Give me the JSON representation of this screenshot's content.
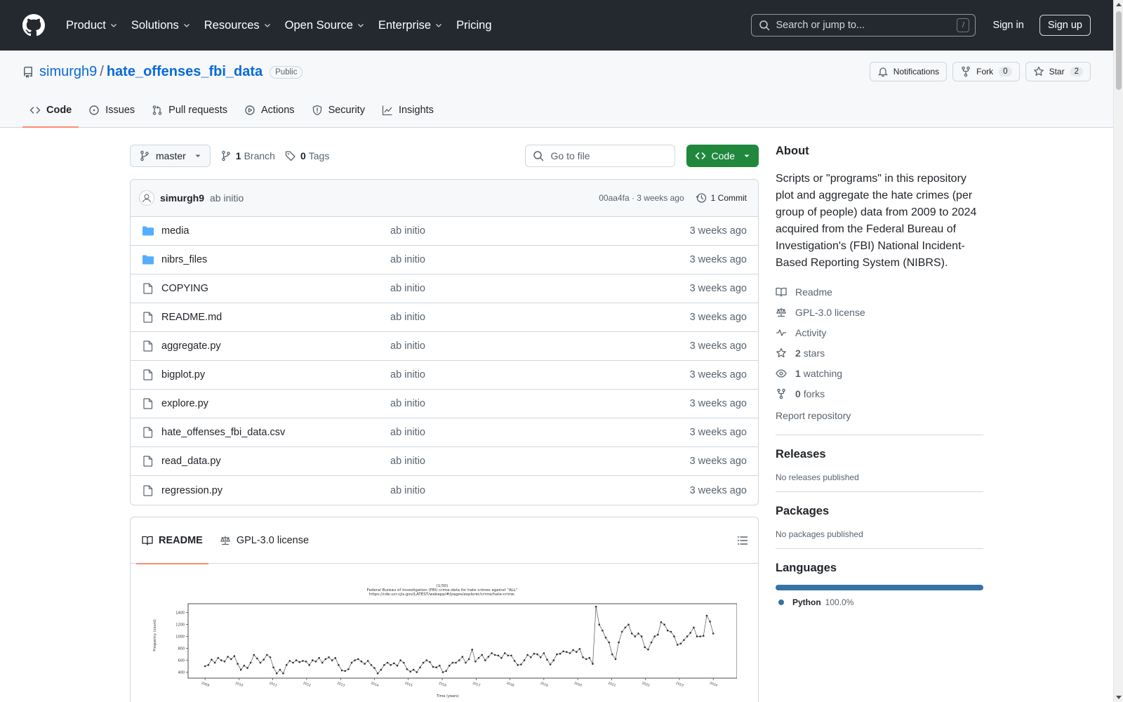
{
  "topnav": {
    "items": [
      {
        "label": "Product",
        "has_menu": true
      },
      {
        "label": "Solutions",
        "has_menu": true
      },
      {
        "label": "Resources",
        "has_menu": true
      },
      {
        "label": "Open Source",
        "has_menu": true
      },
      {
        "label": "Enterprise",
        "has_menu": true
      },
      {
        "label": "Pricing",
        "has_menu": false
      }
    ],
    "search_placeholder": "Search or jump to...",
    "search_shortcut": "/",
    "signin_label": "Sign in",
    "signup_label": "Sign up"
  },
  "repo": {
    "owner": "simurgh9",
    "separator": "/",
    "name": "hate_offenses_fbi_data",
    "visibility": "Public",
    "notifications_label": "Notifications",
    "fork_label": "Fork",
    "fork_count": "0",
    "star_label": "Star",
    "star_count": "2",
    "tabs": [
      {
        "label": "Code",
        "icon": "code-icon",
        "active": true
      },
      {
        "label": "Issues",
        "icon": "issue-icon",
        "active": false
      },
      {
        "label": "Pull requests",
        "icon": "pull-request-icon",
        "active": false
      },
      {
        "label": "Actions",
        "icon": "play-icon",
        "active": false
      },
      {
        "label": "Security",
        "icon": "shield-icon",
        "active": false
      },
      {
        "label": "Insights",
        "icon": "graph-icon",
        "active": false
      }
    ]
  },
  "toolbar": {
    "branch": "master",
    "branch_count": "1",
    "branch_label": "Branch",
    "tag_count": "0",
    "tag_label": "Tags",
    "goto_placeholder": "Go to file",
    "code_button": "Code"
  },
  "commit": {
    "author": "simurgh9",
    "message": "ab initio",
    "meta": "00aa4fa · 3 weeks ago",
    "count_label": "1 Commit"
  },
  "files": [
    {
      "name": "media",
      "type": "dir",
      "message": "ab initio",
      "date": "3 weeks ago"
    },
    {
      "name": "nibrs_files",
      "type": "dir",
      "message": "ab initio",
      "date": "3 weeks ago"
    },
    {
      "name": "COPYING",
      "type": "file",
      "message": "ab initio",
      "date": "3 weeks ago"
    },
    {
      "name": "README.md",
      "type": "file",
      "message": "ab initio",
      "date": "3 weeks ago"
    },
    {
      "name": "aggregate.py",
      "type": "file",
      "message": "ab initio",
      "date": "3 weeks ago"
    },
    {
      "name": "bigplot.py",
      "type": "file",
      "message": "ab initio",
      "date": "3 weeks ago"
    },
    {
      "name": "explore.py",
      "type": "file",
      "message": "ab initio",
      "date": "3 weeks ago"
    },
    {
      "name": "hate_offenses_fbi_data.csv",
      "type": "file",
      "message": "ab initio",
      "date": "3 weeks ago"
    },
    {
      "name": "read_data.py",
      "type": "file",
      "message": "ab initio",
      "date": "3 weeks ago"
    },
    {
      "name": "regression.py",
      "type": "file",
      "message": "ab initio",
      "date": "3 weeks ago"
    }
  ],
  "readme": {
    "tab_readme": "README",
    "tab_license": "GPL-3.0 license",
    "plot_title_1": "(1/30)",
    "plot_title_2": "Federal Bureau of Investigation (FBI) crime-data for hate crimes against \"ALL\"",
    "plot_title_3": "https://cde.ucr.cjis.gov/LATEST/webapp/#/pages/explorer/crime/hate-crime.",
    "plot_ylabel": "Frequency (count)",
    "plot_xlabel": "Time (years)"
  },
  "about": {
    "title": "About",
    "description": "Scripts or \"programs\" in this repository plot and aggregate the hate crimes (per group of people) data from 2009 to 2024 acquired from the Federal Bureau of Investigation's (FBI) National Incident-Based Reporting System (NIBRS).",
    "readme": "Readme",
    "license": "GPL-3.0 license",
    "activity": "Activity",
    "stars_count": "2",
    "stars_label": "stars",
    "watching_count": "1",
    "watching_label": "watching",
    "forks_count": "0",
    "forks_label": "forks",
    "report": "Report repository"
  },
  "releases": {
    "title": "Releases",
    "text": "No releases published"
  },
  "packages": {
    "title": "Packages",
    "text": "No packages published"
  },
  "languages": {
    "title": "Languages",
    "items": [
      {
        "name": "Python",
        "percent": "100.0%",
        "color": "#3572a5"
      }
    ]
  },
  "chart_data": {
    "type": "line",
    "title": "(1/30) Federal Bureau of Investigation (FBI) crime-data for hate crimes against \"ALL\" https://cde.ucr.cjis.gov/LATEST/webapp/#/pages/explorer/crime/hate-crime.",
    "xlabel": "Time (years)",
    "ylabel": "Frequency (count)",
    "ylim": [
      300,
      1550
    ],
    "xlim": [
      2008.5,
      2024.7
    ],
    "yticks": [
      400,
      600,
      800,
      1000,
      1200,
      1400
    ],
    "xticks": [
      "2009",
      "2010",
      "2011",
      "2012",
      "2013",
      "2014",
      "2015",
      "2016",
      "2017",
      "2018",
      "2019",
      "2020",
      "2021",
      "2022",
      "2023",
      "2024"
    ],
    "values": [
      500,
      520,
      610,
      560,
      640,
      600,
      580,
      660,
      620,
      670,
      540,
      440,
      510,
      470,
      560,
      690,
      630,
      560,
      610,
      690,
      650,
      480,
      380,
      440,
      380,
      520,
      590,
      560,
      600,
      570,
      590,
      580,
      520,
      600,
      580,
      640,
      560,
      620,
      650,
      600,
      640,
      520,
      430,
      420,
      450,
      560,
      600,
      620,
      580,
      540,
      590,
      520,
      470,
      380,
      440,
      520,
      560,
      520,
      550,
      510,
      600,
      560,
      450,
      410,
      440,
      400,
      480,
      560,
      600,
      570,
      490,
      480,
      510,
      400,
      420,
      510,
      560,
      560,
      600,
      660,
      560,
      620,
      780,
      580,
      640,
      690,
      600,
      660,
      720,
      690,
      680,
      640,
      720,
      680,
      680,
      590,
      520,
      530,
      600,
      690,
      650,
      710,
      700,
      650,
      720,
      610,
      530,
      600,
      700,
      710,
      750,
      740,
      720,
      770,
      740,
      790,
      650,
      620,
      640,
      540,
      1500,
      1200,
      1100,
      980,
      900,
      700,
      620,
      900,
      1080,
      1150,
      1200,
      1050,
      1000,
      1050,
      1000,
      820,
      780,
      900,
      1000,
      1030,
      1240,
      1200,
      1100,
      1080,
      1000,
      860,
      880,
      940,
      1000,
      1060,
      1150,
      1000,
      1000,
      1010,
      1350,
      1250,
      1050
    ]
  }
}
